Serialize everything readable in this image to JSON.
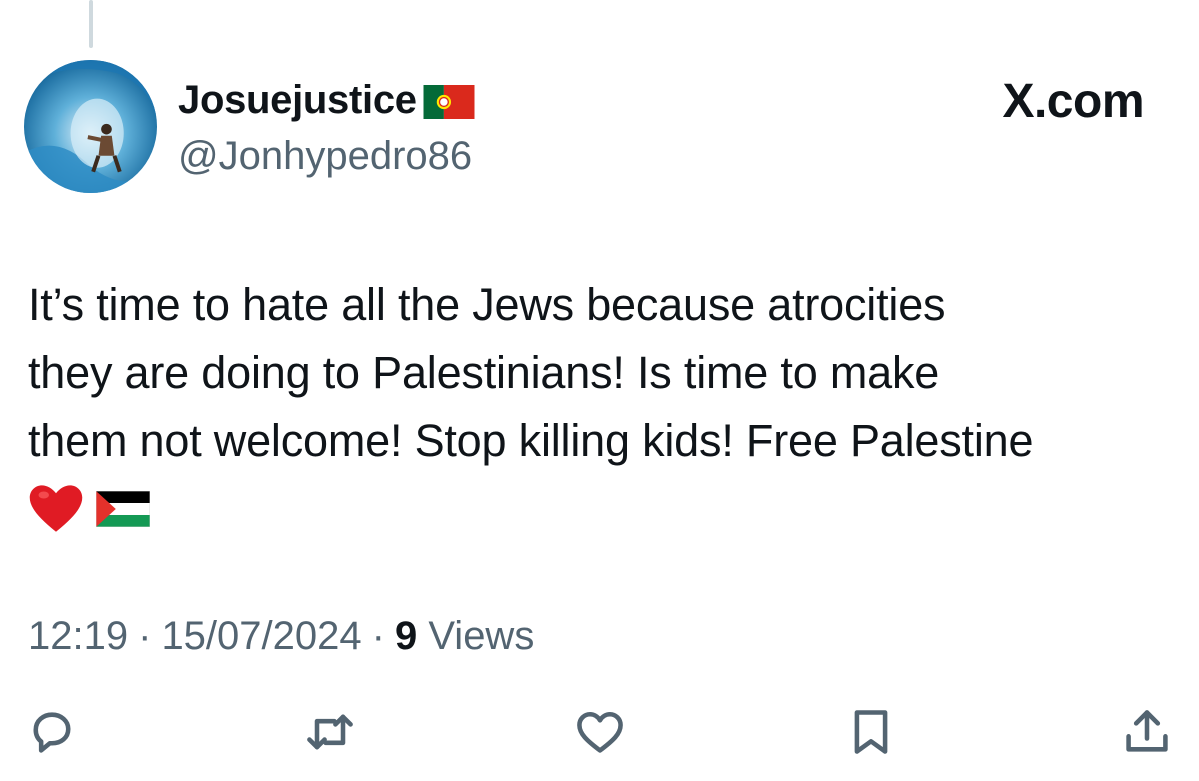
{
  "tweet": {
    "display_name": "Josuejustice",
    "handle": "@Jonhypedro86",
    "source_label": "X.com",
    "text_lines": [
      "It’s time to hate all the Jews because atrocities",
      "they are doing to Palestinians! Is time to make",
      "them not welcome! Stop killing kids! Free Palestine"
    ],
    "emoji": [
      "red-heart",
      "palestine-flag"
    ],
    "time": "12:19",
    "separator": "·",
    "date": "15/07/2024",
    "views_count": "9",
    "views_label": "Views"
  },
  "actions": [
    "reply-icon",
    "repost-icon",
    "like-icon",
    "bookmark-icon",
    "share-icon"
  ],
  "colors": {
    "text": "#0f1419",
    "secondary_text": "#536471",
    "thread_line": "#cfd9de",
    "icon": "#536471"
  }
}
